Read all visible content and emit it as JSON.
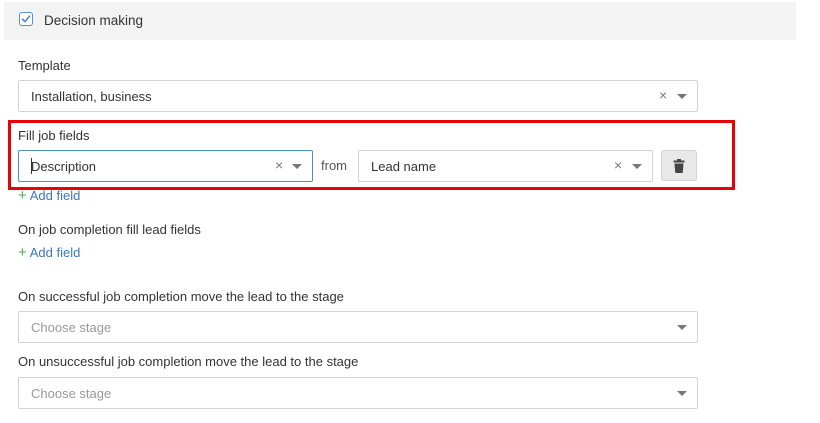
{
  "section": {
    "title": "Decision making",
    "checked": true
  },
  "template": {
    "label": "Template",
    "value": "Installation, business"
  },
  "fill_job_fields": {
    "label": "Fill job fields",
    "job_field_value": "Description",
    "from_label": "from",
    "lead_field_value": "Lead name",
    "add_field_label": "Add field"
  },
  "completion_fill": {
    "label": "On job completion fill lead fields",
    "add_field_label": "Add field"
  },
  "success_stage": {
    "label": "On successful job completion move the lead to the stage",
    "placeholder": "Choose stage"
  },
  "fail_stage": {
    "label": "On unsuccessful job completion move the lead to the stage",
    "placeholder": "Choose stage"
  },
  "icons": {
    "clear": "×",
    "checkbox": "check-icon",
    "delete": "trash-icon",
    "caret": "chevron-down-icon"
  },
  "colors": {
    "highlight": "#e8000b",
    "link": "#3a78b8",
    "plus": "#4caf50",
    "focus_border": "#4a90c8"
  }
}
